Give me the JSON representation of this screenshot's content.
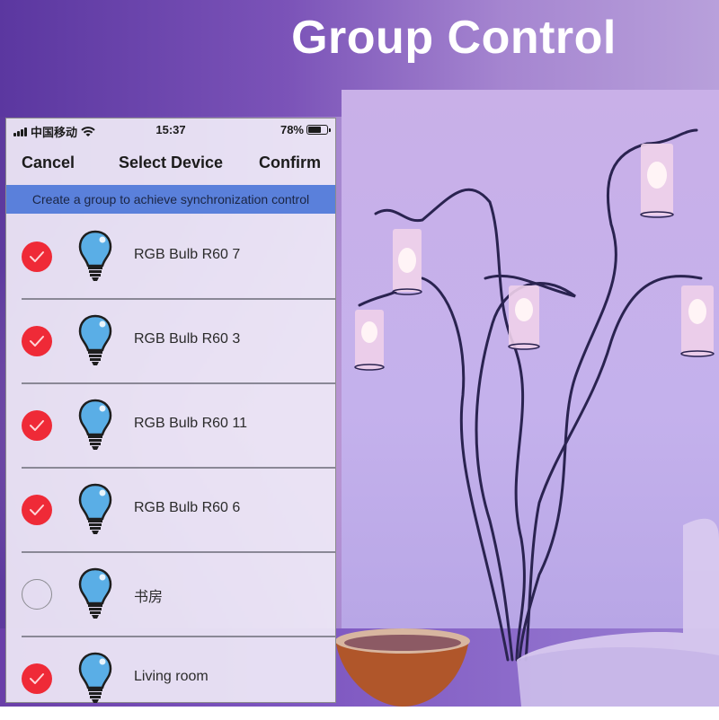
{
  "banner_title": "Group Control",
  "status_bar": {
    "carrier": "中国移动",
    "time": "15:37",
    "battery_percent": "78%",
    "battery_level": 0.78
  },
  "nav": {
    "cancel_label": "Cancel",
    "title": "Select Device",
    "confirm_label": "Confirm"
  },
  "hint": "Create a group to achieve synchronization control",
  "devices": [
    {
      "name": "RGB Bulb R60 7",
      "selected": true,
      "icon": "light-bulb-icon"
    },
    {
      "name": "RGB Bulb R60 3",
      "selected": true,
      "icon": "light-bulb-icon"
    },
    {
      "name": "RGB Bulb R60 11",
      "selected": true,
      "icon": "light-bulb-icon"
    },
    {
      "name": "RGB Bulb R60 6",
      "selected": true,
      "icon": "light-bulb-icon"
    },
    {
      "name": "书房",
      "selected": false,
      "icon": "light-bulb-icon"
    },
    {
      "name": "Living room",
      "selected": true,
      "icon": "light-bulb-icon"
    }
  ],
  "colors": {
    "checked": "#ef2a37",
    "banner": "#5a80db",
    "bulb": "#5aaee6"
  }
}
